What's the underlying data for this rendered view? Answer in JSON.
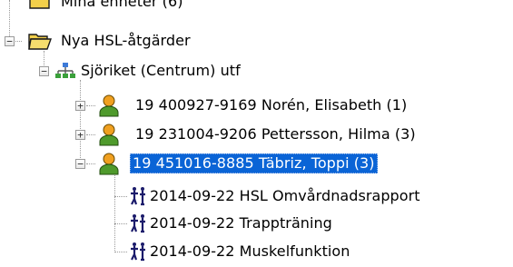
{
  "tree": {
    "partial_top_label": "Mina enheter (6)",
    "group_label": "Nya HSL-åtgärder",
    "unit_label": "Sjöriket (Centrum) utf",
    "patients": [
      {
        "label": "19 400927-9169  Norén, Elisabeth (1)",
        "expander": "+",
        "selected": false
      },
      {
        "label": "19 231004-9206  Pettersson, Hilma (3)",
        "expander": "+",
        "selected": false
      },
      {
        "label": "19 451016-8885  Täbriz, Toppi (3)",
        "expander": "−",
        "selected": true
      }
    ],
    "measures": [
      {
        "label": "2014-09-22 HSL Omvårdnadsrapport"
      },
      {
        "label": "2014-09-22 Trappträning"
      },
      {
        "label": "2014-09-22 Muskelfunktion"
      }
    ],
    "group_expander": "−",
    "unit_expander": "−"
  },
  "colors": {
    "selection_bg": "#0a64d6",
    "folder_yellow": "#f2cf4a",
    "person_green": "#4f9a2c",
    "person_orange": "#f0a020",
    "measure_navy": "#1b1b6b"
  },
  "icons": {
    "folder": "folder-icon",
    "open_folder": "open-folder-icon",
    "org_unit": "org-unit-icon",
    "patient": "patient-icon",
    "measure": "care-measure-icon"
  }
}
